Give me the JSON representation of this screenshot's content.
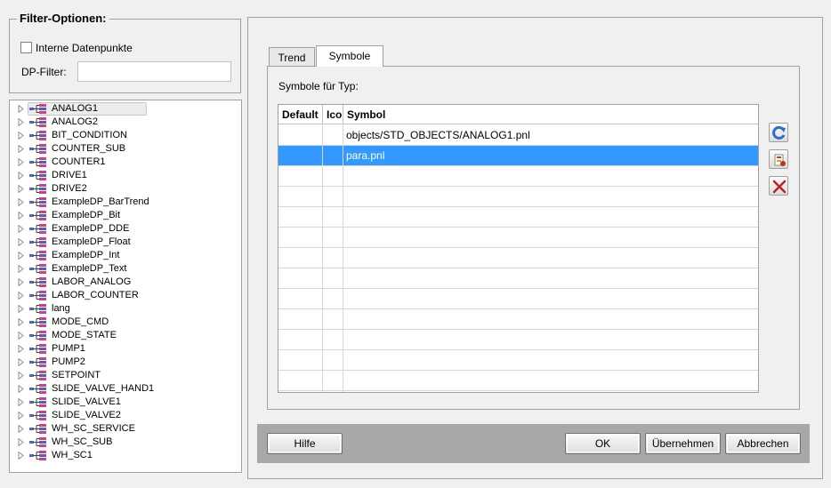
{
  "filter": {
    "title": "Filter-Optionen:",
    "internal_dp_label": "Interne Datenpunkte",
    "internal_dp_checked": false,
    "dp_filter_label": "DP-Filter:",
    "dp_filter_value": ""
  },
  "tree": {
    "selected": "ANALOG1",
    "items": [
      "ANALOG1",
      "ANALOG2",
      "BIT_CONDITION",
      "COUNTER_SUB",
      "COUNTER1",
      "DRIVE1",
      "DRIVE2",
      "ExampleDP_BarTrend",
      "ExampleDP_Bit",
      "ExampleDP_DDE",
      "ExampleDP_Float",
      "ExampleDP_Int",
      "ExampleDP_Text",
      "LABOR_ANALOG",
      "LABOR_COUNTER",
      "lang",
      "MODE_CMD",
      "MODE_STATE",
      "PUMP1",
      "PUMP2",
      "SETPOINT",
      "SLIDE_VALVE_HAND1",
      "SLIDE_VALVE1",
      "SLIDE_VALVE2",
      "WH_SC_SERVICE",
      "WH_SC_SUB",
      "WH_SC1"
    ]
  },
  "tabs": {
    "trend": "Trend",
    "symbole": "Symbole",
    "active": "Symbole"
  },
  "symbols": {
    "type_label": "Symbole für Typ:",
    "columns": [
      "Default",
      "Icon",
      "Symbol"
    ],
    "rows": [
      {
        "default": "",
        "icon": "",
        "symbol": "objects/STD_OBJECTS/ANALOG1.pnl",
        "selected": false
      },
      {
        "default": "",
        "icon": "",
        "symbol": "para.pnl",
        "selected": true
      }
    ],
    "side_buttons": [
      "refresh-icon",
      "edit-symbol-icon",
      "delete-icon"
    ]
  },
  "buttons": {
    "help": "Hilfe",
    "ok": "OK",
    "apply": "Übernehmen",
    "cancel": "Abbrechen"
  },
  "colors": {
    "selection": "#3399ff",
    "background": "#f0f0f0",
    "bottom_bar": "#a8a8a8"
  }
}
